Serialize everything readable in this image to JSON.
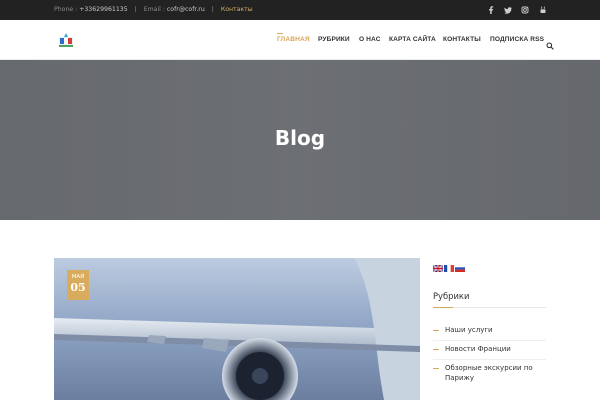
{
  "topbar": {
    "phone_label": "Phone :",
    "phone_value": "+33629961135",
    "email_label": "Email :",
    "email_value": "cofr@cofr.ru",
    "contacts_link": "Контакты",
    "social": [
      "facebook-icon",
      "twitter-icon",
      "instagram-icon",
      "youtube-icon"
    ]
  },
  "nav": {
    "items": [
      "Главная",
      "Рубрики",
      "О нас",
      "Карта сайта",
      "Контакты",
      "Подписка RSS"
    ],
    "active_index": 0,
    "search_icon": "search-icon"
  },
  "hero": {
    "title": "Blog"
  },
  "post": {
    "month": "МАЙ",
    "day": "05"
  },
  "sidebar": {
    "languages": [
      "en",
      "fr",
      "ru"
    ],
    "title": "Рубрики",
    "categories": [
      "Наши услуги",
      "Новости Франции",
      "Обзорные экскурсии по Парижу"
    ]
  },
  "colors": {
    "accent": "#d4a85c",
    "topbar": "#222222",
    "hero": "#6a6d72"
  }
}
